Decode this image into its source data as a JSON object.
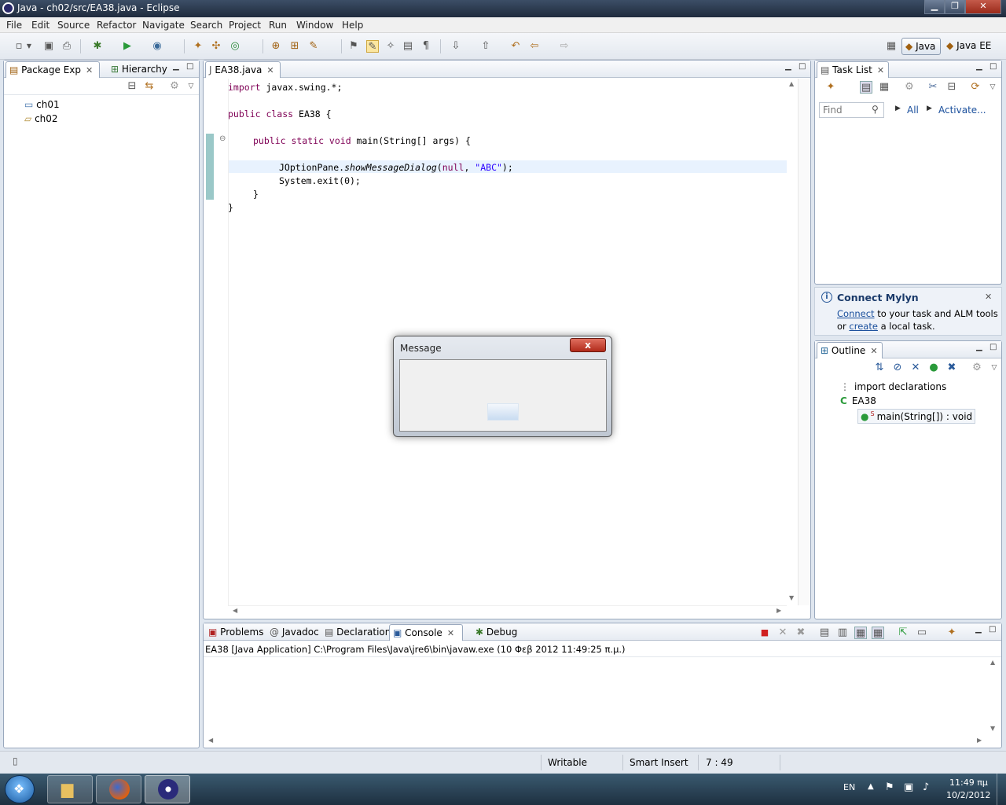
{
  "window": {
    "title": "Java - ch02/src/EA38.java - Eclipse"
  },
  "menu": [
    "File",
    "Edit",
    "Source",
    "Refactor",
    "Navigate",
    "Search",
    "Project",
    "Run",
    "Window",
    "Help"
  ],
  "perspectives": {
    "java": "Java",
    "javaee": "Java EE"
  },
  "package_explorer": {
    "tabs": [
      "Package Exp",
      "Hierarchy"
    ],
    "items": [
      "ch01",
      "ch02"
    ]
  },
  "editor": {
    "tab": "EA38.java",
    "lines": {
      "l1_kw": "import",
      "l1_rest": " javax.swing.*;",
      "l3_kw": "public class",
      "l3_rest": " EA38 {",
      "l5_kw": "public static void",
      "l5_rest": " main(String[] args) {",
      "l7_a": "JOptionPane.",
      "l7_method": "showMessageDialog",
      "l7_b": "(",
      "l7_null": "null",
      "l7_c": ", ",
      "l7_str": "\"ABC\"",
      "l7_d": ");",
      "l8": "System.exit(0);",
      "l9": "}",
      "l10": "}"
    }
  },
  "dialog": {
    "title": "Message",
    "close": "x"
  },
  "task_list": {
    "tab": "Task List",
    "find_placeholder": "Find",
    "filter_all": "All",
    "activate": "Activate..."
  },
  "mylyn": {
    "title": "Connect Mylyn",
    "connect_link": "Connect",
    "text1": " to your task and ALM tools",
    "text2_pre": "or ",
    "create_link": "create",
    "text2_post": " a local task."
  },
  "outline": {
    "tab": "Outline",
    "items": [
      "import declarations",
      "EA38",
      "main(String[]) : void"
    ]
  },
  "bottom": {
    "tabs": [
      "Problems",
      "Javadoc",
      "Declaration",
      "Console",
      "Debug"
    ],
    "console_header": "EA38 [Java Application] C:\\Program Files\\Java\\jre6\\bin\\javaw.exe (10 Φεβ 2012 11:49:25 π.μ.)"
  },
  "statusbar": {
    "writable": "Writable",
    "insert": "Smart Insert",
    "position": "7 : 49"
  },
  "taskbar": {
    "lang": "EN",
    "time": "11:49 πμ",
    "date": "10/2/2012"
  }
}
